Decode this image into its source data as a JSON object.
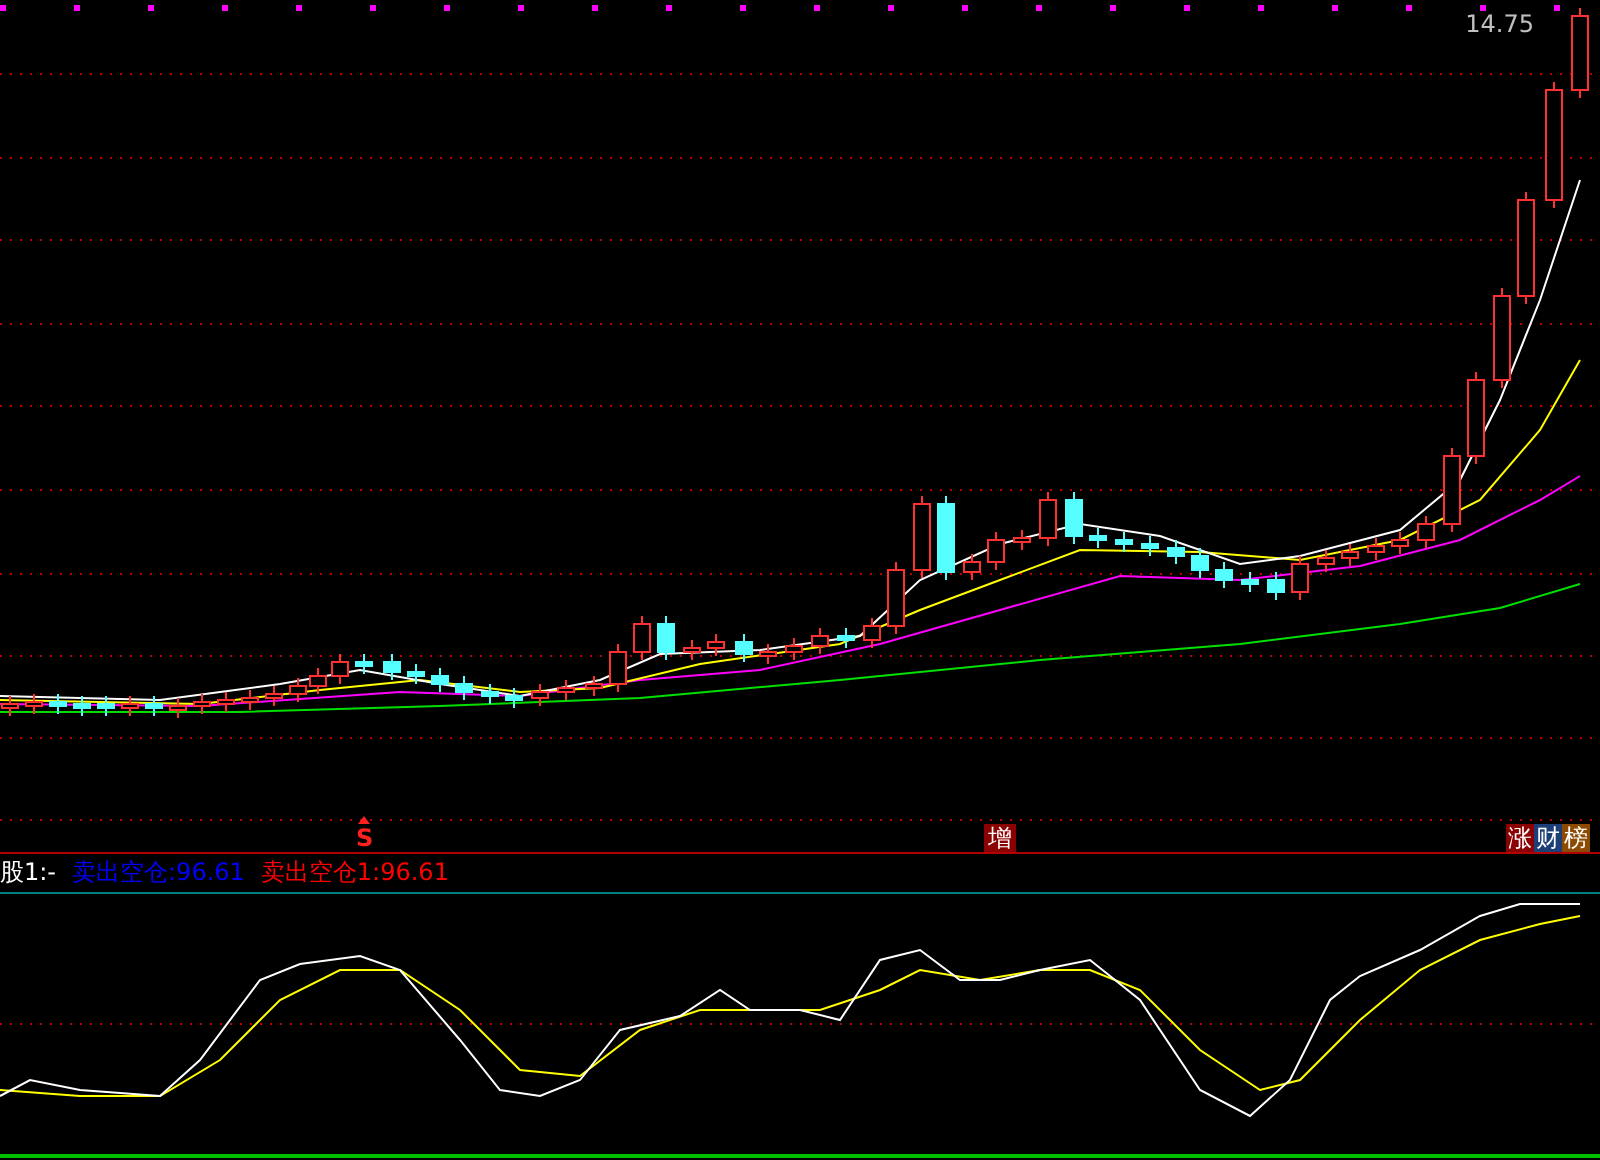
{
  "price_chart": {
    "price_label": "14.75",
    "signals": [
      {
        "kind": "arrow",
        "text": "S"
      },
      {
        "kind": "box",
        "text": "增"
      }
    ],
    "badges": [
      {
        "text": "涨",
        "color": "#8b0000"
      },
      {
        "text": "财",
        "color": "#1c3f78"
      },
      {
        "text": "榜",
        "color": "#8b4a00"
      }
    ]
  },
  "indicator": {
    "legend": [
      {
        "text": "股1:-",
        "color": "#ffffff"
      },
      {
        "text": "卖出空仓:96.61",
        "color": "#0000ff"
      },
      {
        "text": "卖出空仓1:96.61",
        "color": "#ff0000"
      }
    ]
  }
}
